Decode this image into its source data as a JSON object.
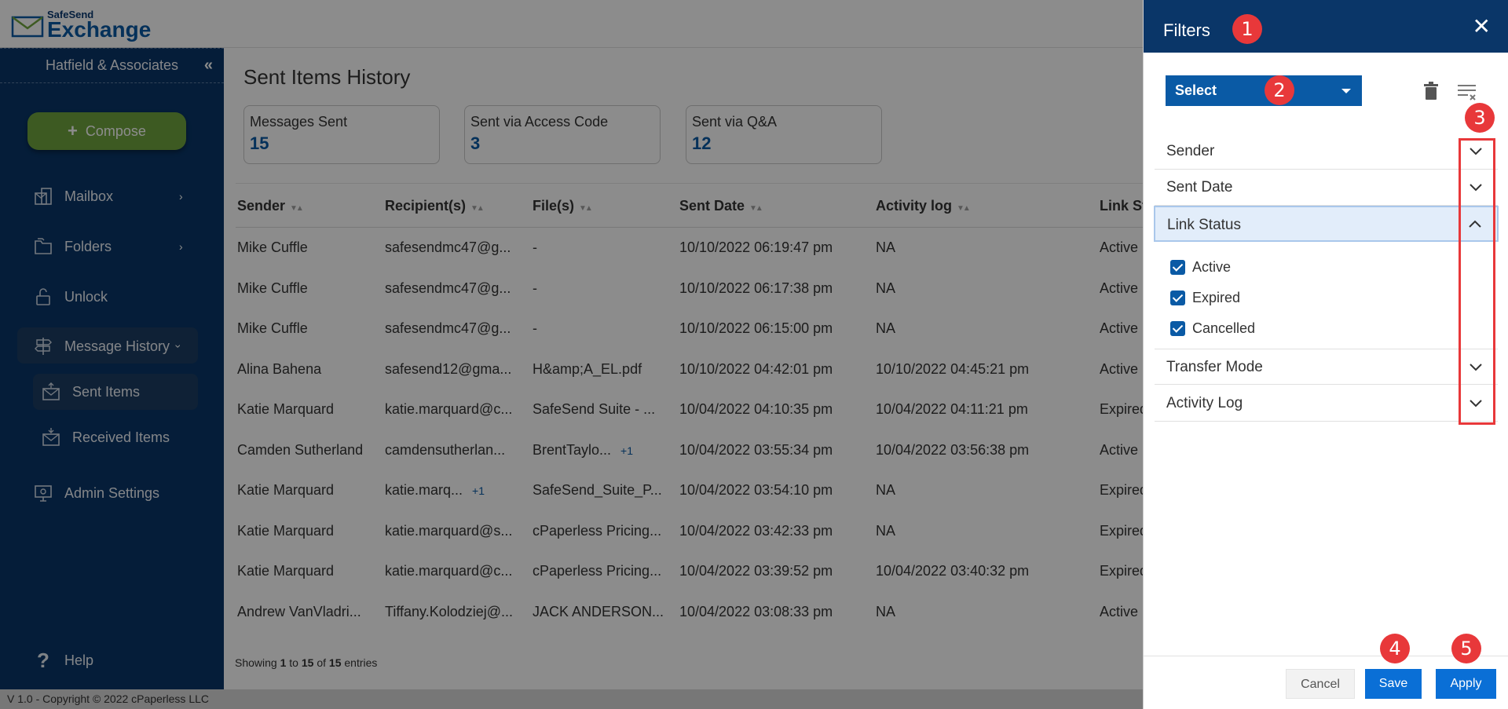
{
  "brand": {
    "line1": "SafeSend",
    "line2": "Exchange",
    "accent": "#0a5aa5",
    "sidebar_bg": "#0a3668"
  },
  "sidebar": {
    "org": "Hatfield & Associates",
    "compose": "Compose",
    "items": [
      {
        "label": "Mailbox",
        "icon": "mailbox-icon"
      },
      {
        "label": "Folders",
        "icon": "folders-icon"
      },
      {
        "label": "Unlock",
        "icon": "unlock-icon"
      },
      {
        "label": "Message History",
        "icon": "signpost-icon"
      },
      {
        "label": "Sent Items",
        "icon": "sent-icon"
      },
      {
        "label": "Received Items",
        "icon": "received-icon"
      },
      {
        "label": "Admin Settings",
        "icon": "admin-icon"
      },
      {
        "label": "Help",
        "icon": "help-icon"
      }
    ]
  },
  "footer": "V 1.0 - Copyright © 2022  cPaperless LLC",
  "main": {
    "title": "Sent Items History",
    "cards": [
      {
        "label": "Messages Sent",
        "value": "15"
      },
      {
        "label": "Sent via Access Code",
        "value": "3"
      },
      {
        "label": "Sent via Q&A",
        "value": "12"
      }
    ],
    "columns": [
      "Sender",
      "Recipient(s)",
      "File(s)",
      "Sent Date",
      "Activity log",
      "Link Sta"
    ],
    "rows": [
      {
        "sender": "Mike Cuffle",
        "recipient": "safesendmc47@g...",
        "file": "-",
        "sent": "10/10/2022 06:19:47 pm",
        "activity": "NA",
        "status": "Active"
      },
      {
        "sender": "Mike Cuffle",
        "recipient": "safesendmc47@g...",
        "file": "-",
        "sent": "10/10/2022 06:17:38 pm",
        "activity": "NA",
        "status": "Active"
      },
      {
        "sender": "Mike Cuffle",
        "recipient": "safesendmc47@g...",
        "file": "-",
        "sent": "10/10/2022 06:15:00 pm",
        "activity": "NA",
        "status": "Active"
      },
      {
        "sender": "Alina Bahena",
        "recipient": "safesend12@gma...",
        "file": "H&amp;A_EL.pdf",
        "sent": "10/10/2022 04:42:01 pm",
        "activity": "10/10/2022 04:45:21 pm",
        "status": "Active"
      },
      {
        "sender": "Katie Marquard",
        "recipient": "katie.marquard@c...",
        "file": "SafeSend Suite - ...",
        "sent": "10/04/2022 04:10:35 pm",
        "activity": "10/04/2022 04:11:21 pm",
        "status": "Expired"
      },
      {
        "sender": "Camden Sutherland",
        "recipient": "camdensutherlan...",
        "file": "BrentTaylo...",
        "file_extra": "+1",
        "sent": "10/04/2022 03:55:34 pm",
        "activity": "10/04/2022 03:56:38 pm",
        "status": "Active"
      },
      {
        "sender": "Katie Marquard",
        "recipient": "katie.marq...",
        "recipient_extra": "+1",
        "file": "SafeSend_Suite_P...",
        "sent": "10/04/2022 03:54:10 pm",
        "activity": "NA",
        "status": "Expired"
      },
      {
        "sender": "Katie Marquard",
        "recipient": "katie.marquard@s...",
        "file": "cPaperless Pricing...",
        "sent": "10/04/2022 03:42:33 pm",
        "activity": "NA",
        "status": "Expired"
      },
      {
        "sender": "Katie Marquard",
        "recipient": "katie.marquard@c...",
        "file": "cPaperless Pricing...",
        "sent": "10/04/2022 03:39:52 pm",
        "activity": "10/04/2022 03:40:32 pm",
        "status": "Expired"
      },
      {
        "sender": "Andrew VanVladri...",
        "recipient": "Tiffany.Kolodziej@...",
        "file": "JACK ANDERSON...",
        "sent": "10/04/2022 03:08:33 pm",
        "activity": "NA",
        "status": "Active"
      }
    ],
    "showing": {
      "prefix": "Showing ",
      "from": "1",
      "mid1": " to ",
      "to": "15",
      "mid2": " of ",
      "total": "15",
      "suffix": " entries"
    }
  },
  "filters": {
    "title": "Filters",
    "select": "Select",
    "sections": [
      "Sender",
      "Sent Date",
      "Link Status",
      "Transfer Mode",
      "Activity Log"
    ],
    "link_status_options": [
      "Active",
      "Expired",
      "Cancelled"
    ],
    "cancel": "Cancel",
    "save": "Save",
    "apply": "Apply"
  },
  "annotations": [
    "1",
    "2",
    "3",
    "4",
    "5"
  ]
}
